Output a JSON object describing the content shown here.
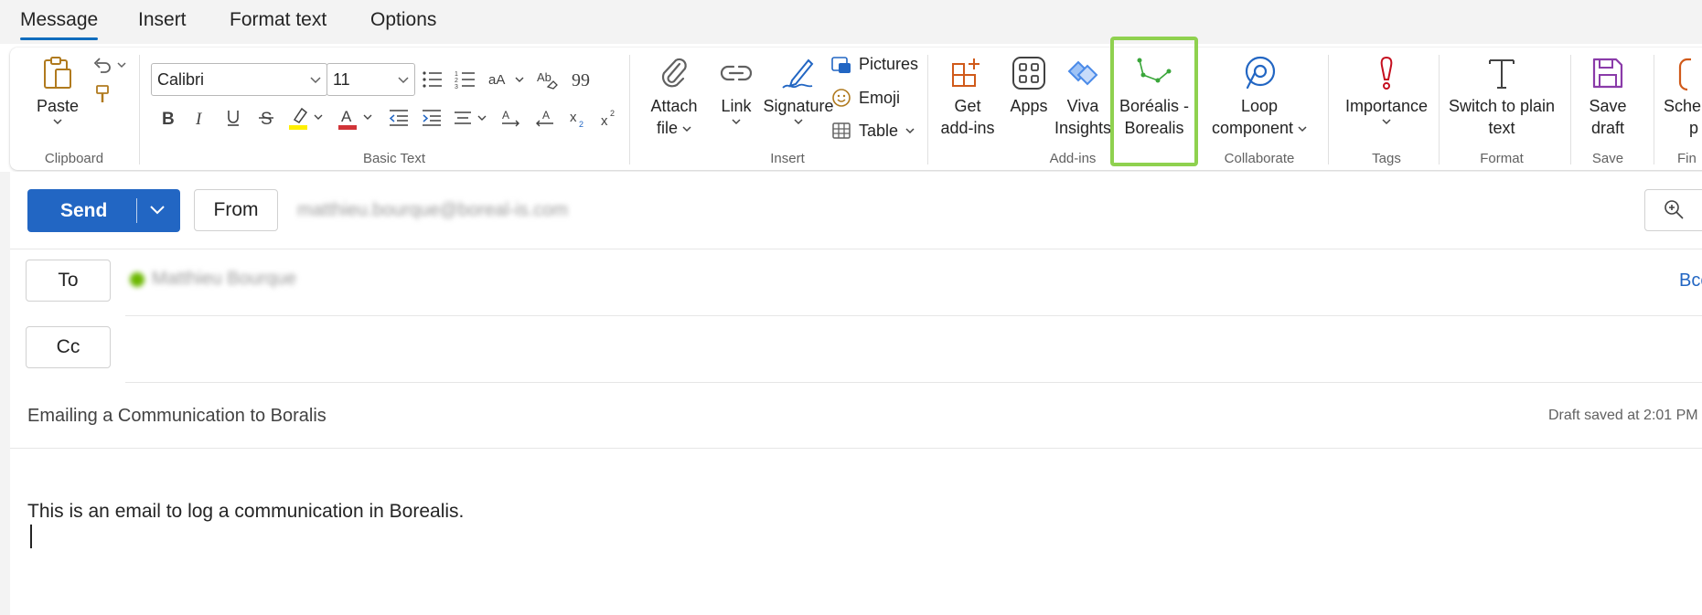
{
  "menu": {
    "tabs": [
      {
        "label": "Message",
        "active": true
      },
      {
        "label": "Insert"
      },
      {
        "label": "Format text"
      },
      {
        "label": "Options"
      }
    ]
  },
  "ribbon": {
    "clipboard": {
      "paste_label": "Paste",
      "group_label": "Clipboard"
    },
    "basic_text": {
      "font_name": "Calibri",
      "font_size": "11",
      "group_label": "Basic Text"
    },
    "insert": {
      "attach_label_1": "Attach",
      "attach_label_2": "file",
      "link_label": "Link",
      "signature_label": "Signature",
      "pictures_label": "Pictures",
      "emoji_label": "Emoji",
      "table_label": "Table",
      "group_label": "Insert"
    },
    "addins": {
      "get_label_1": "Get",
      "get_label_2": "add-ins",
      "apps_label": "Apps",
      "viva_label_1": "Viva",
      "viva_label_2": "Insights",
      "borealis_label_1": "Boréalis -",
      "borealis_label_2": "Borealis",
      "group_label": "Add-ins",
      "highlight_color": "#8fd14f"
    },
    "collaborate": {
      "loop_label_1": "Loop",
      "loop_label_2": "component",
      "group_label": "Collaborate"
    },
    "tags": {
      "importance_label": "Importance",
      "group_label": "Tags"
    },
    "format": {
      "switch_label_1": "Switch to plain",
      "switch_label_2": "text",
      "group_label": "Format"
    },
    "save": {
      "save_label_1": "Save",
      "save_label_2": "draft",
      "group_label": "Save"
    },
    "schedule": {
      "label_1": "Sche",
      "label_2": "p",
      "group_label": "Fin"
    }
  },
  "compose": {
    "send_label": "Send",
    "from_label": "From",
    "from_value": "matthieu.bourque@boreal-is.com",
    "to_label": "To",
    "to_recipient": "Matthieu Bourque",
    "cc_label": "Cc",
    "bcc_label": "Bcc",
    "subject": "Emailing a Communication to Boralis",
    "draft_status": "Draft saved at 2:01 PM",
    "body": "This is an email to log a communication in Borealis."
  },
  "colors": {
    "accent": "#0f6cbd",
    "send": "#2266c3",
    "importance": "#c50f1f",
    "getaddins": "#d05a1a",
    "save": "#8a3ba9"
  }
}
